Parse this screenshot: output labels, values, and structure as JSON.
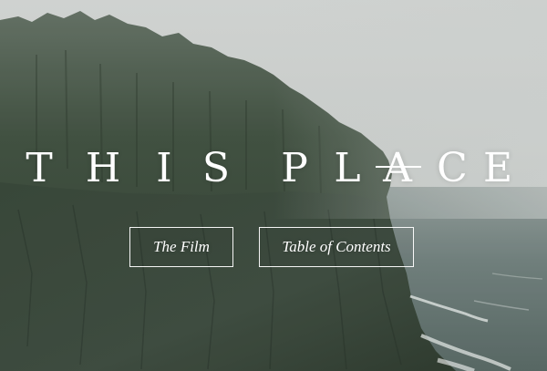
{
  "hero": {
    "title_letters": [
      "T",
      "H",
      "I",
      "S",
      "P",
      "L",
      "A",
      "C",
      "E"
    ]
  },
  "nav": {
    "film_label": "The Film",
    "toc_label": "Table of Contents"
  },
  "colors": {
    "text": "#ffffff",
    "sky": "#c9cccb",
    "sea": "#5d6e6c",
    "forest": "#2d3b2d"
  }
}
